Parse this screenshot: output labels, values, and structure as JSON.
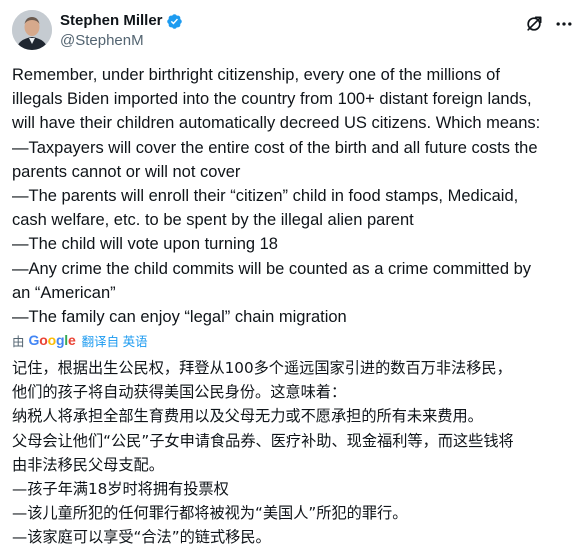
{
  "author": {
    "display_name": "Stephen Miller",
    "handle": "@StephenM"
  },
  "icons": {
    "verified": "verified-badge-icon",
    "grok": "grok-icon",
    "more": "more-icon"
  },
  "colors": {
    "verified_blue": "#1d9bf0",
    "secondary_text": "#536471",
    "link": "#1d9bf0"
  },
  "tweet_lines": [
    "Remember, under birthright citizenship, every one of the millions of",
    "illegals Biden imported into the country from 100+ distant foreign lands,",
    "will have their children automatically decreed US citizens. Which means:",
    "—Taxpayers will cover the entire cost of the birth and all future costs the",
    "parents cannot or will not cover",
    "—The parents will enroll their “citizen” child in food stamps, Medicaid,",
    "cash welfare, etc. to be spent by the illegal alien parent",
    "—The child will vote upon turning 18",
    "—Any crime the child commits will be counted as a crime committed by",
    "an “American”",
    "—The family can enjoy “legal” chain migration"
  ],
  "translate_bar": {
    "prefix": "由",
    "provider": "Google",
    "link_text": "翻译自 英语"
  },
  "translation_lines": [
    "记住，根据出生公民权，拜登从100多个遥远国家引进的数百万非法移民，",
    "他们的孩子将自动获得美国公民身份。这意味着：",
    "纳税人将承担全部生育费用以及父母无力或不愿承担的所有未来费用。",
    "父母会让他们“公民”子女申请食品券、医疗补助、现金福利等，而这些钱将",
    "由非法移民父母支配。",
    "—孩子年满18岁时将拥有投票权",
    "—该儿童所犯的任何罪行都将被视为“美国人”所犯的罪行。",
    "—该家庭可以享受“合法”的链式移民。"
  ]
}
